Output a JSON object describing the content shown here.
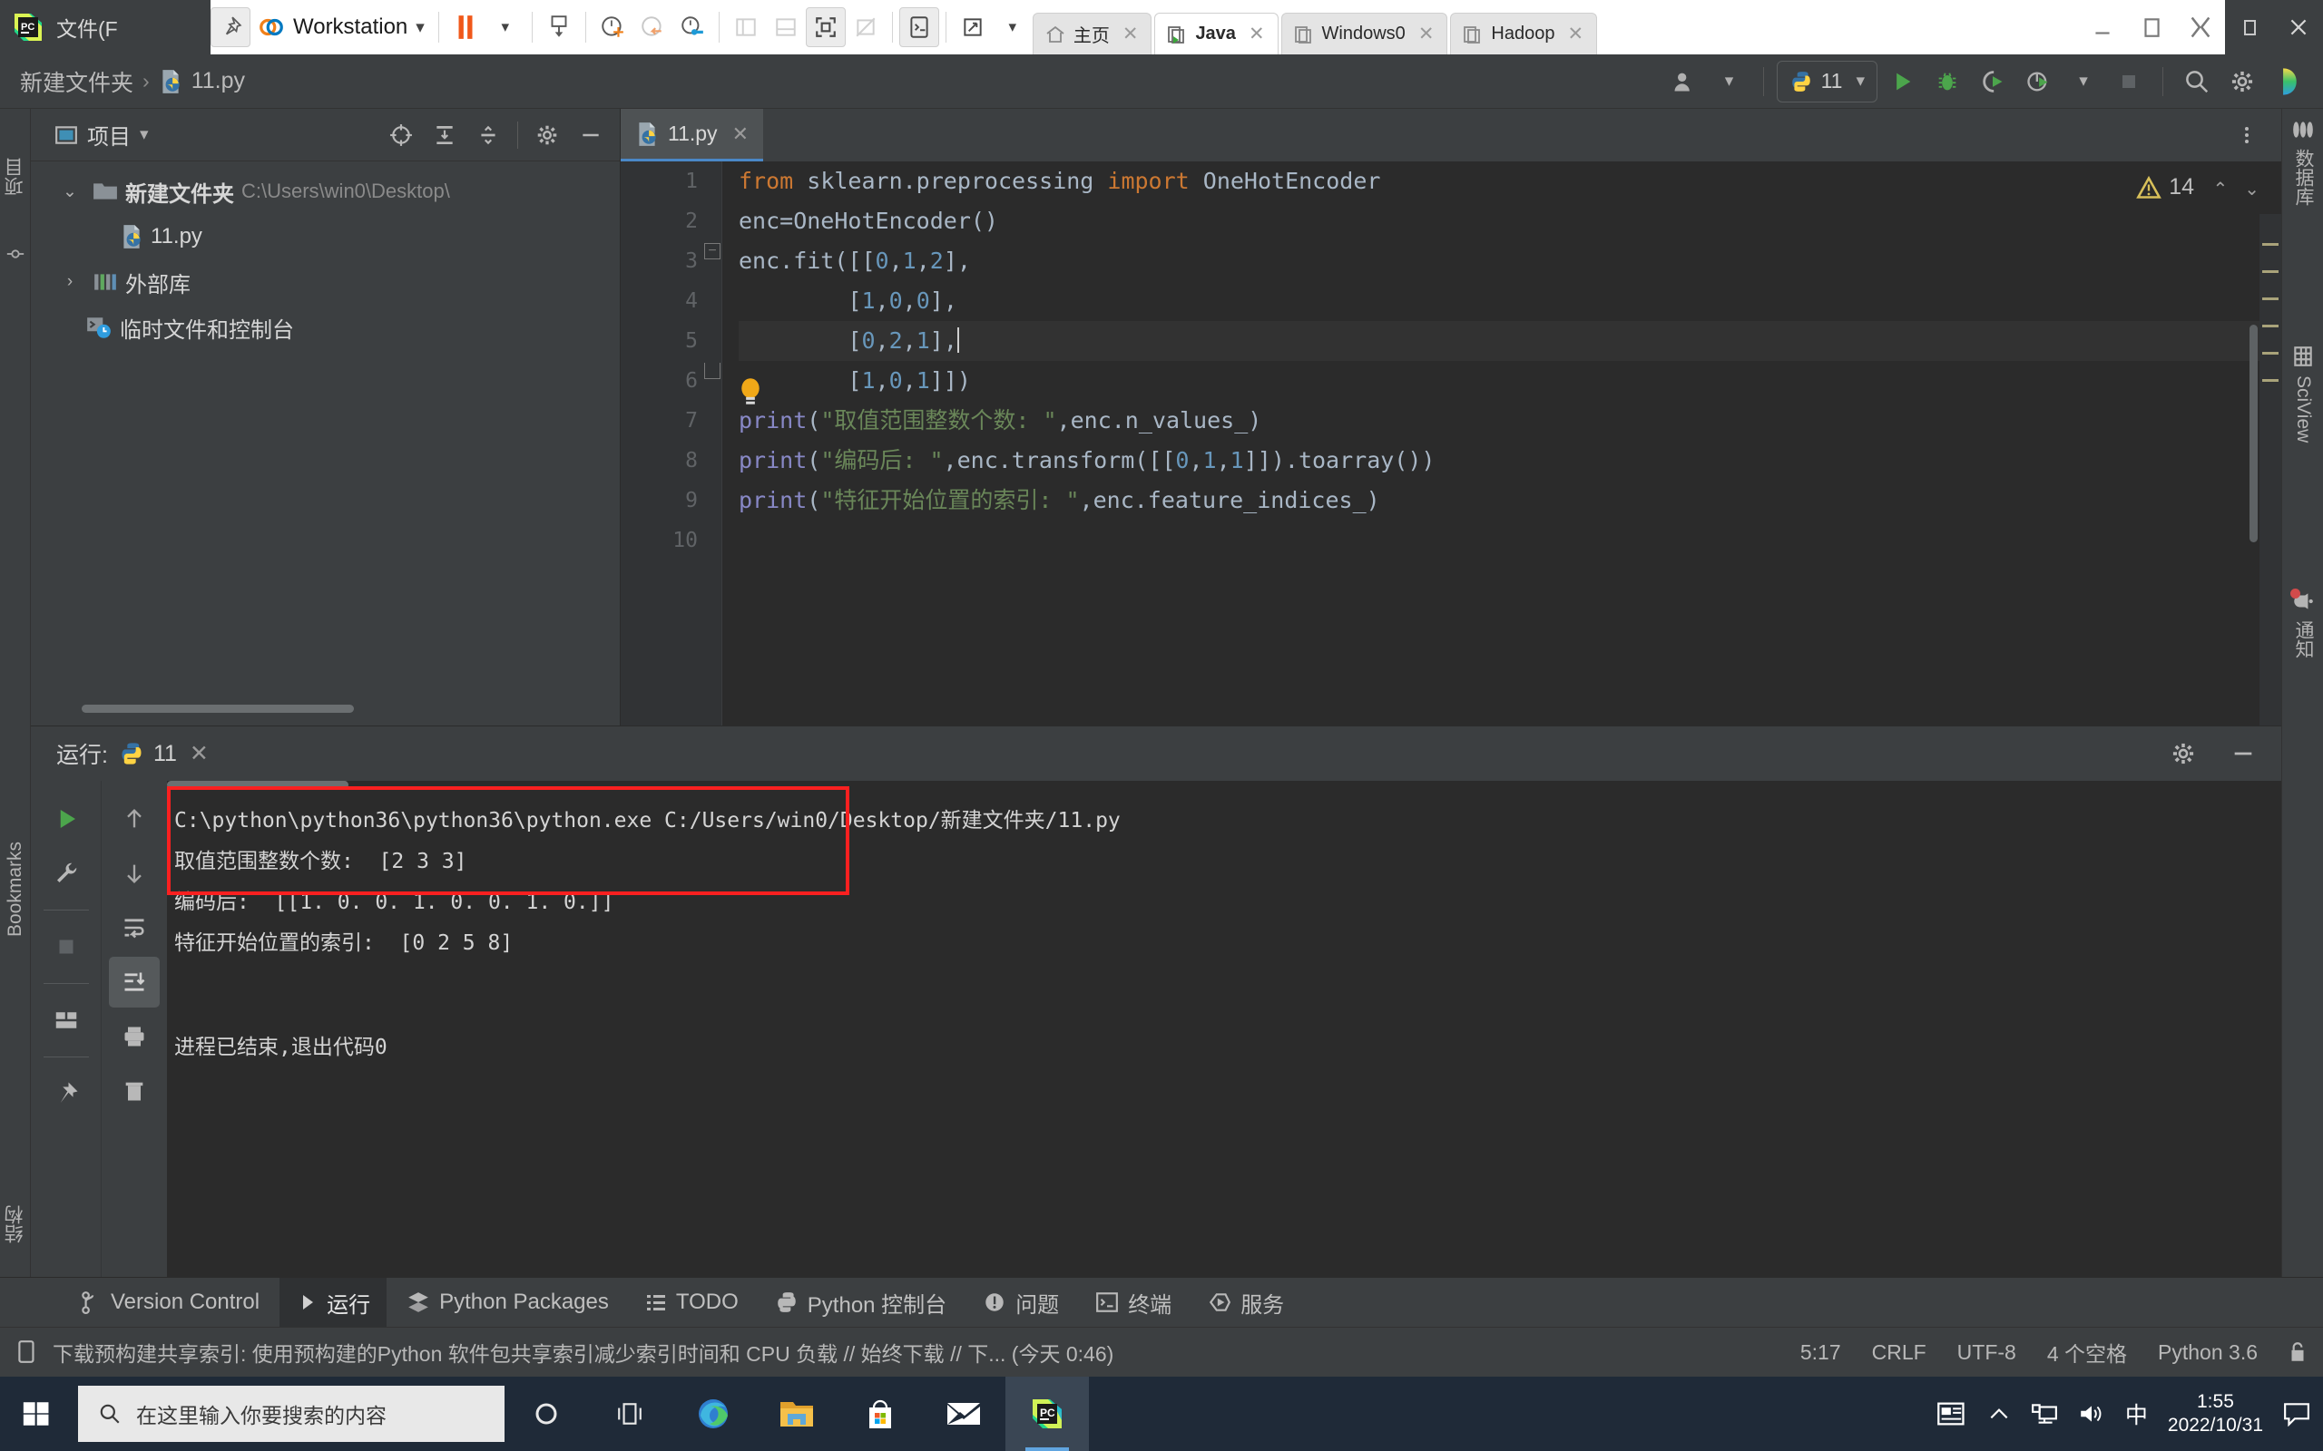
{
  "vmware": {
    "file_menu": "文件(F",
    "workspace": "Workstation",
    "pin_icon": "pin-icon",
    "tabs": [
      {
        "label": "主页",
        "icon": "home-icon",
        "selected": false,
        "close": "✕"
      },
      {
        "label": "Java",
        "icon": "vm-icon",
        "selected": true,
        "close": "✕"
      },
      {
        "label": "Windows0",
        "icon": "vm-icon",
        "selected": false,
        "close": "✕"
      },
      {
        "label": "Hadoop",
        "icon": "vm-icon",
        "selected": false,
        "close": "✕"
      }
    ],
    "window_controls": [
      "minimize",
      "restore",
      "fullscreen",
      "unity",
      "close"
    ]
  },
  "ide": {
    "breadcrumb": {
      "folder": "新建文件夹",
      "separator": "›",
      "file": "11.py"
    },
    "toolbar": {
      "account_icon": "user-icon",
      "run_config_name": "11",
      "run_config_chevron": "▾",
      "run_icon": "run-icon",
      "debug_icon": "debug-icon",
      "coverage_icon": "coverage-icon",
      "profile_icon": "profile-icon",
      "profile_chevron": "▾",
      "stop_icon": "stop-icon",
      "search_icon": "search-icon",
      "settings_icon": "gear-icon",
      "updates_icon": "updates-icon"
    }
  },
  "left_strip": {
    "items": [
      {
        "label": "项目",
        "icon": "project-icon"
      },
      {
        "label": "提交",
        "icon": "commit-icon"
      },
      {
        "label": "结构",
        "icon": "structure-icon"
      },
      {
        "label": "Bookmarks",
        "icon": "bookmark-icon"
      }
    ]
  },
  "right_strip": {
    "items": [
      {
        "label": "数据库",
        "icon": "database-icon"
      },
      {
        "label": "SciView",
        "icon": "sciview-icon"
      },
      {
        "label": "通知",
        "icon": "bell-icon",
        "badge": true
      }
    ]
  },
  "project_panel": {
    "title": "项目",
    "title_chevron": "▾",
    "icons": [
      "target-icon",
      "expand-all-icon",
      "collapse-all-icon",
      "gear-icon",
      "hide-icon"
    ],
    "tree": [
      {
        "indent": 0,
        "arrow": "⌄",
        "icon": "folder-icon",
        "label": "新建文件夹",
        "path": "C:\\Users\\win0\\Desktop\\",
        "bold": true
      },
      {
        "indent": 1,
        "arrow": "",
        "icon": "python-file-icon",
        "label": "11.py",
        "path": "",
        "bold": false
      },
      {
        "indent": 0,
        "arrow": "›",
        "icon": "library-icon",
        "label": "外部库",
        "path": "",
        "bold": false
      },
      {
        "indent": 0,
        "arrow": "",
        "icon": "scratches-icon",
        "label": "临时文件和控制台",
        "path": "",
        "bold": false
      }
    ]
  },
  "editor": {
    "tab": {
      "label": "11.py",
      "icon": "python-file-icon",
      "close": "✕"
    },
    "more_icon": "more-vertical-icon",
    "warning_count": "14",
    "warning_icon": "warning-triangle-icon",
    "up_arrow": "⌃",
    "down_arrow": "⌄",
    "bulb_icon": "lightbulb-icon",
    "line_numbers": [
      "1",
      "2",
      "3",
      "4",
      "5",
      "6",
      "7",
      "8",
      "9",
      "10"
    ],
    "code": [
      {
        "n": 1,
        "tokens": [
          {
            "t": "from ",
            "c": "kw"
          },
          {
            "t": "sklearn.preprocessing ",
            "c": "id"
          },
          {
            "t": "import ",
            "c": "kw"
          },
          {
            "t": "OneHotEncoder",
            "c": "id"
          }
        ]
      },
      {
        "n": 2,
        "tokens": [
          {
            "t": "enc=OneHotEncoder()",
            "c": "id"
          }
        ]
      },
      {
        "n": 3,
        "tokens": [
          {
            "t": "enc.fit([[",
            "c": "id"
          },
          {
            "t": "0",
            "c": "num"
          },
          {
            "t": ",",
            "c": "id"
          },
          {
            "t": "1",
            "c": "num"
          },
          {
            "t": ",",
            "c": "id"
          },
          {
            "t": "2",
            "c": "num"
          },
          {
            "t": "],",
            "c": "id"
          }
        ]
      },
      {
        "n": 4,
        "tokens": [
          {
            "t": "        [",
            "c": "id"
          },
          {
            "t": "1",
            "c": "num"
          },
          {
            "t": ",",
            "c": "id"
          },
          {
            "t": "0",
            "c": "num"
          },
          {
            "t": ",",
            "c": "id"
          },
          {
            "t": "0",
            "c": "num"
          },
          {
            "t": "],",
            "c": "id"
          }
        ]
      },
      {
        "n": 5,
        "tokens": [
          {
            "t": "        [",
            "c": "id"
          },
          {
            "t": "0",
            "c": "num"
          },
          {
            "t": ",",
            "c": "id"
          },
          {
            "t": "2",
            "c": "num"
          },
          {
            "t": ",",
            "c": "id"
          },
          {
            "t": "1",
            "c": "num"
          },
          {
            "t": "],",
            "c": "id"
          }
        ],
        "highlight": true,
        "caret": true
      },
      {
        "n": 6,
        "tokens": [
          {
            "t": "        [",
            "c": "id"
          },
          {
            "t": "1",
            "c": "num"
          },
          {
            "t": ",",
            "c": "id"
          },
          {
            "t": "0",
            "c": "num"
          },
          {
            "t": ",",
            "c": "id"
          },
          {
            "t": "1",
            "c": "num"
          },
          {
            "t": "]])",
            "c": "id"
          }
        ]
      },
      {
        "n": 7,
        "tokens": [
          {
            "t": "print",
            "c": "fn"
          },
          {
            "t": "(",
            "c": "id"
          },
          {
            "t": "\"取值范围整数个数: \"",
            "c": "str"
          },
          {
            "t": ",enc.n_values_)",
            "c": "id"
          }
        ]
      },
      {
        "n": 8,
        "tokens": [
          {
            "t": "print",
            "c": "fn"
          },
          {
            "t": "(",
            "c": "id"
          },
          {
            "t": "\"编码后: \"",
            "c": "str"
          },
          {
            "t": ",enc.transform([[",
            "c": "id"
          },
          {
            "t": "0",
            "c": "num"
          },
          {
            "t": ",",
            "c": "id"
          },
          {
            "t": "1",
            "c": "num"
          },
          {
            "t": ",",
            "c": "id"
          },
          {
            "t": "1",
            "c": "num"
          },
          {
            "t": "]]).toarray())",
            "c": "id"
          }
        ]
      },
      {
        "n": 9,
        "tokens": [
          {
            "t": "print",
            "c": "fn"
          },
          {
            "t": "(",
            "c": "id"
          },
          {
            "t": "\"特征开始位置的索引: \"",
            "c": "str"
          },
          {
            "t": ",enc.feature_indices_)",
            "c": "id"
          }
        ]
      },
      {
        "n": 10,
        "tokens": []
      }
    ]
  },
  "run_window": {
    "title": "运行:",
    "tab_label": "11",
    "tab_icon": "python-icon",
    "tab_close": "✕",
    "settings_icon": "gear-icon",
    "hide_icon": "minimize-icon",
    "toolbar_primary": [
      "rerun-icon",
      "wrench-icon",
      "stop-icon",
      "layout-icon",
      "print-icon",
      "pin-icon"
    ],
    "toolbar_secondary": [
      "up-icon",
      "down-icon",
      "soft-wrap-icon",
      "scroll-to-end-icon",
      "print-icon",
      "trash-icon"
    ],
    "console_lines": [
      "C:\\python\\python36\\python36\\python.exe C:/Users/win0/Desktop/新建文件夹/11.py",
      "取值范围整数个数:  [2 3 3]",
      "编码后:  [[1. 0. 0. 1. 0. 0. 1. 0.]]",
      "特征开始位置的索引:  [0 2 5 8]",
      "",
      "进程已结束,退出代码0"
    ],
    "highlight_color": "#fa2020"
  },
  "bottom_tabs": [
    {
      "label": "Version Control",
      "icon": "branch-icon",
      "selected": false
    },
    {
      "label": "运行",
      "icon": "run-icon",
      "selected": true
    },
    {
      "label": "Python Packages",
      "icon": "packages-icon",
      "selected": false
    },
    {
      "label": "TODO",
      "icon": "todo-icon",
      "selected": false
    },
    {
      "label": "Python 控制台",
      "icon": "python-icon",
      "selected": false
    },
    {
      "label": "问题",
      "icon": "problems-icon",
      "selected": false
    },
    {
      "label": "终端",
      "icon": "terminal-icon",
      "selected": false
    },
    {
      "label": "服务",
      "icon": "services-icon",
      "selected": false
    }
  ],
  "status_bar": {
    "icon": "notification-icon",
    "message": "下载预构建共享索引: 使用预构建的Python 软件包共享索引减少索引时间和 CPU 负载 // 始终下载 // 下... (今天 0:46)",
    "caret_position": "5:17",
    "line_separator": "CRLF",
    "encoding": "UTF-8",
    "indent": "4 个空格",
    "interpreter": "Python 3.6",
    "lock_icon": "lock-icon"
  },
  "taskbar": {
    "start_icon": "windows-start-icon",
    "search_placeholder": "在这里输入你要搜索的内容",
    "search_icon": "search-icon",
    "cortana_icon": "cortana-icon",
    "taskview_icon": "task-view-icon",
    "apps": [
      {
        "name": "edge-icon",
        "active": false,
        "running": false
      },
      {
        "name": "file-explorer-icon",
        "active": false,
        "running": true
      },
      {
        "name": "microsoft-store-icon",
        "active": false,
        "running": false
      },
      {
        "name": "mail-icon",
        "active": false,
        "running": false
      },
      {
        "name": "pycharm-icon",
        "active": true,
        "running": true
      }
    ],
    "tray": {
      "news_icon": "news-icon",
      "chevron_icon": "show-hidden-icons-icon",
      "network_icon": "network-icon",
      "volume_icon": "volume-icon",
      "ime_label": "中",
      "time": "1:55",
      "date": "2022/10/31",
      "action_center_icon": "action-center-icon"
    }
  }
}
